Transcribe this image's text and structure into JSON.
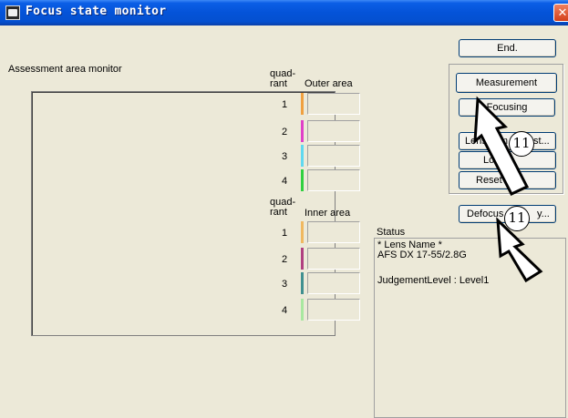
{
  "window": {
    "title": "Focus state monitor",
    "close_glyph": "✕",
    "app_icon": "monitor-icon"
  },
  "assessment": {
    "title": "Assessment area monitor"
  },
  "outer": {
    "quad_line1": "quad-",
    "quad_line2": "rant",
    "heading": "Outer area",
    "rows": [
      {
        "num": "1",
        "color": "#f0a040"
      },
      {
        "num": "2",
        "color": "#e040c8"
      },
      {
        "num": "3",
        "color": "#60d8f0"
      },
      {
        "num": "4",
        "color": "#30d040"
      }
    ]
  },
  "inner": {
    "quad_line1": "quad-",
    "quad_line2": "rant",
    "heading": "Inner area",
    "rows": [
      {
        "num": "1",
        "color": "#f0b860"
      },
      {
        "num": "2",
        "color": "#b04080"
      },
      {
        "num": "3",
        "color": "#409090"
      },
      {
        "num": "4",
        "color": "#a8e8a0"
      }
    ]
  },
  "buttons": {
    "end": "End.",
    "measurement": "Measurement",
    "focusing": "Focusing",
    "lens_name": "LensNam",
    "lens_name_tail": "st...",
    "log": "Log",
    "reset_all": "Reset all I",
    "defocus": "Defocus",
    "defocus_tail": "y..."
  },
  "status": {
    "label": "Status",
    "lines": [
      "* Lens Name *",
      "AFS DX 17-55/2.8G",
      "",
      "JudgementLevel : Level1"
    ]
  },
  "annotations": {
    "badge_top": "11",
    "badge_bottom": "11"
  }
}
